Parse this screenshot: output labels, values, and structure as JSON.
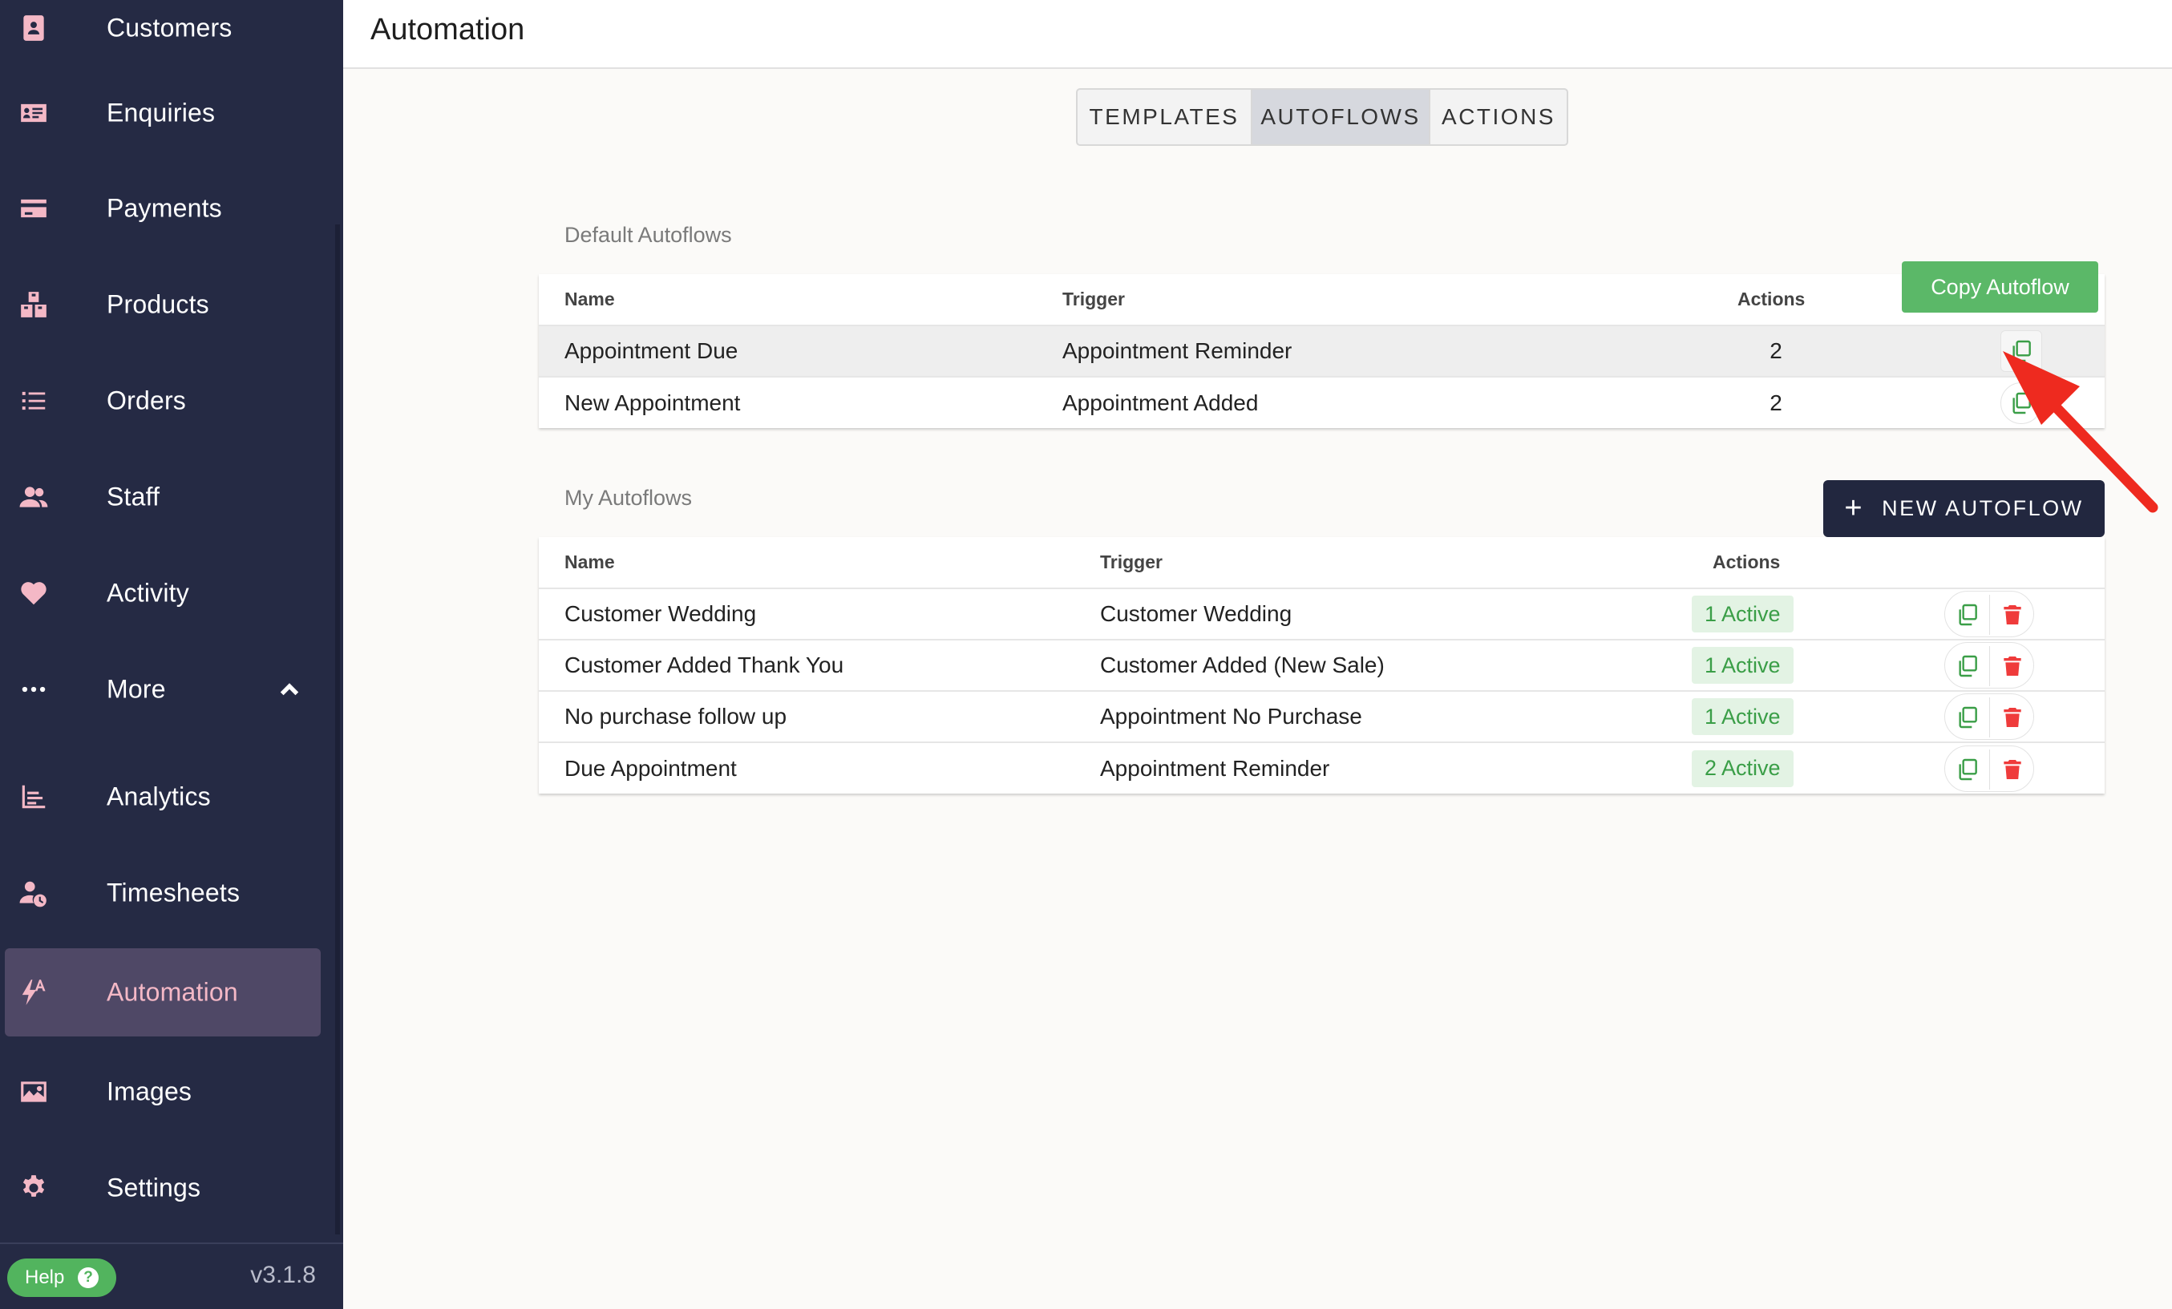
{
  "sidebar": {
    "items": [
      {
        "label": "Customers",
        "icon": "customer-icon"
      },
      {
        "label": "Enquiries",
        "icon": "enquiry-card-icon"
      },
      {
        "label": "Payments",
        "icon": "credit-card-icon"
      },
      {
        "label": "Products",
        "icon": "boxes-icon"
      },
      {
        "label": "Orders",
        "icon": "list-icon"
      },
      {
        "label": "Staff",
        "icon": "people-icon"
      },
      {
        "label": "Activity",
        "icon": "heart-pulse-icon"
      },
      {
        "label": "More",
        "icon": "ellipsis-icon"
      },
      {
        "label": "Analytics",
        "icon": "bar-chart-icon"
      },
      {
        "label": "Timesheets",
        "icon": "user-clock-icon"
      },
      {
        "label": "Automation",
        "icon": "bolt-a-icon"
      },
      {
        "label": "Images",
        "icon": "image-icon"
      },
      {
        "label": "Settings",
        "icon": "gear-icon"
      }
    ],
    "help_label": "Help",
    "version": "v3.1.8"
  },
  "header": {
    "title": "Automation"
  },
  "tabs": {
    "templates": "TEMPLATES",
    "autoflows": "AUTOFLOWS",
    "actions": "ACTIONS",
    "active": "AUTOFLOWS"
  },
  "default_autoflows": {
    "title": "Default Autoflows",
    "columns": {
      "name": "Name",
      "trigger": "Trigger",
      "actions": "Actions"
    },
    "copy_button_label": "Copy Autoflow",
    "rows": [
      {
        "name": "Appointment Due",
        "trigger": "Appointment Reminder",
        "actions": "2"
      },
      {
        "name": "New Appointment",
        "trigger": "Appointment Added",
        "actions": "2"
      }
    ]
  },
  "my_autoflows": {
    "title": "My Autoflows",
    "new_button_label": "NEW AUTOFLOW",
    "columns": {
      "name": "Name",
      "trigger": "Trigger",
      "actions": "Actions"
    },
    "rows": [
      {
        "name": "Customer Wedding",
        "trigger": "Customer Wedding",
        "actions": "1 Active"
      },
      {
        "name": "Customer Added Thank You",
        "trigger": "Customer Added (New Sale)",
        "actions": "1 Active"
      },
      {
        "name": "No purchase follow up",
        "trigger": "Appointment No Purchase",
        "actions": "1 Active"
      },
      {
        "name": "Due Appointment",
        "trigger": "Appointment Reminder",
        "actions": "2 Active"
      }
    ]
  },
  "colors": {
    "sidebar_bg": "#252a44",
    "accent_pink": "#f4b8c6",
    "active_green": "#3a9e47",
    "delete_red": "#ef3b3b",
    "annotation_arrow": "#ee2a1f"
  }
}
